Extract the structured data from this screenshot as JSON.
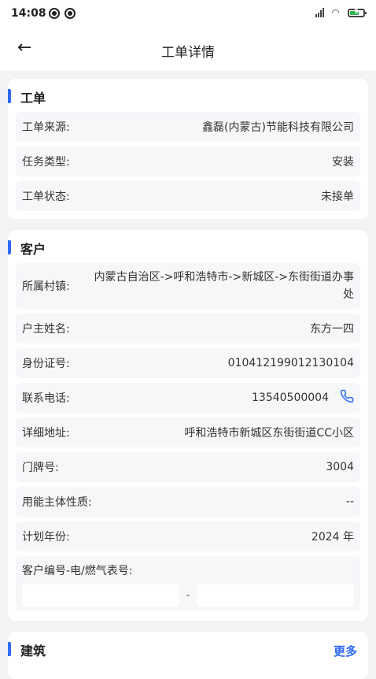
{
  "status_bar": {
    "time": "14:08",
    "battery": "9"
  },
  "nav": {
    "back_icon": "←",
    "title": "工单详情"
  },
  "sections": {
    "order": {
      "title": "工单",
      "rows": [
        {
          "label": "工单来源:",
          "value": "鑫磊(内蒙古)节能科技有限公司"
        },
        {
          "label": "任务类型:",
          "value": "安装"
        },
        {
          "label": "工单状态:",
          "value": "未接单"
        }
      ]
    },
    "customer": {
      "title": "客户",
      "village_label": "所属村镇:",
      "village_value": "内蒙古自治区->呼和浩特市->新城区->东街街道办事处",
      "name_label": "户主姓名:",
      "name_value": "东方一四",
      "id_label": "身份证号:",
      "id_value": "010412199012130104",
      "phone_label": "联系电话:",
      "phone_value": "13540500004",
      "address_label": "详细地址:",
      "address_value": "呼和浩特市新城区东街街道CC小区",
      "door_label": "门牌号:",
      "door_value": "3004",
      "nature_label": "用能主体性质:",
      "nature_value": "--",
      "year_label": "计划年份:",
      "year_value": "2024 年",
      "meter_label": "客户编号-电/燃气表号:",
      "meter_separator": "-"
    },
    "building": {
      "title": "建筑",
      "more_label": "更多"
    }
  },
  "colors": {
    "accent": "#2f6bf5",
    "background": "#f2f3f5"
  },
  "icons": {
    "phone": "phone-icon",
    "back": "back-arrow-icon"
  }
}
